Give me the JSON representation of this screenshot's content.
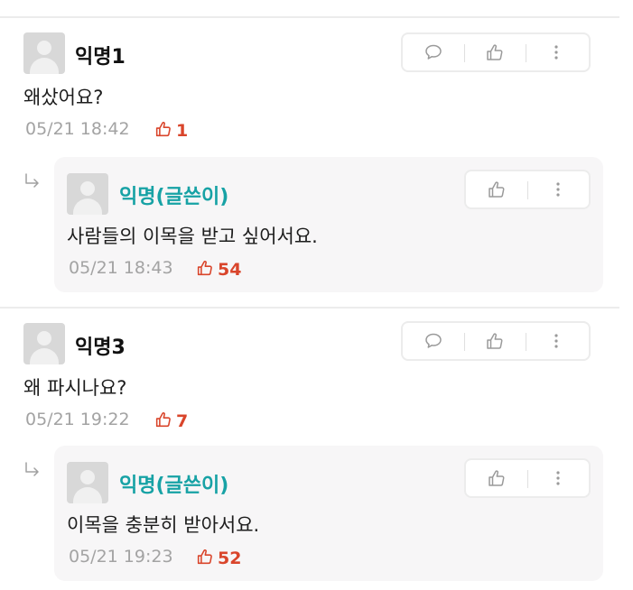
{
  "comments": [
    {
      "author": "익명1",
      "text": "왜샀어요?",
      "time": "05/21 18:42",
      "likes": "1",
      "reply": {
        "author": "익명(글쓴이)",
        "text": "사람들의 이목을 받고 싶어서요.",
        "time": "05/21 18:43",
        "likes": "54"
      }
    },
    {
      "author": "익명3",
      "text": "왜 파시나요?",
      "time": "05/21 19:22",
      "likes": "7",
      "reply": {
        "author": "익명(글쓴이)",
        "text": "이목을 충분히 받아서요.",
        "time": "05/21 19:23",
        "likes": "52"
      }
    }
  ],
  "icons": {
    "comment": "speech-bubble-icon",
    "like": "thumbs-up-icon",
    "more": "more-vertical-icon",
    "reply_arrow": "reply-arrow-icon",
    "avatar": "default-avatar-icon"
  },
  "colors": {
    "op_name": "#17a2a5",
    "likes": "#d9452b",
    "meta": "#a3a3a3",
    "reply_bg": "#f7f6f7"
  }
}
